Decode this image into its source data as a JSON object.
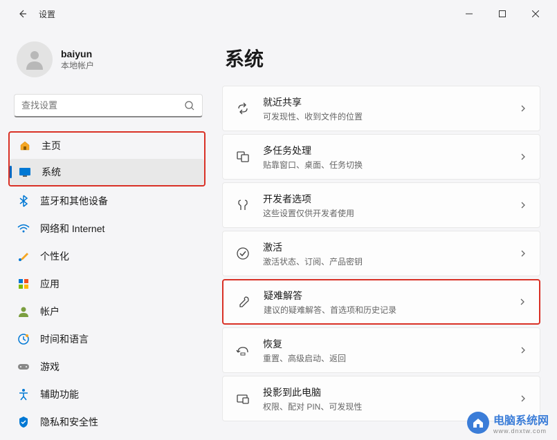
{
  "app": {
    "title": "设置"
  },
  "user": {
    "name": "baiyun",
    "account_type": "本地帐户"
  },
  "search": {
    "placeholder": "查找设置"
  },
  "nav": [
    {
      "id": "home",
      "label": "主页",
      "icon": "home"
    },
    {
      "id": "system",
      "label": "系统",
      "icon": "system",
      "active": true
    },
    {
      "id": "bluetooth",
      "label": "蓝牙和其他设备",
      "icon": "bluetooth"
    },
    {
      "id": "network",
      "label": "网络和 Internet",
      "icon": "wifi"
    },
    {
      "id": "personalization",
      "label": "个性化",
      "icon": "brush"
    },
    {
      "id": "apps",
      "label": "应用",
      "icon": "apps"
    },
    {
      "id": "accounts",
      "label": "帐户",
      "icon": "account"
    },
    {
      "id": "time",
      "label": "时间和语言",
      "icon": "time"
    },
    {
      "id": "gaming",
      "label": "游戏",
      "icon": "gaming"
    },
    {
      "id": "accessibility",
      "label": "辅助功能",
      "icon": "accessibility"
    },
    {
      "id": "privacy",
      "label": "隐私和安全性",
      "icon": "privacy"
    }
  ],
  "page": {
    "title": "系统"
  },
  "settings": [
    {
      "id": "nearby",
      "title": "就近共享",
      "desc": "可发现性、收到文件的位置",
      "icon": "share"
    },
    {
      "id": "multitask",
      "title": "多任务处理",
      "desc": "贴靠窗口、桌面、任务切换",
      "icon": "multitask"
    },
    {
      "id": "developer",
      "title": "开发者选项",
      "desc": "这些设置仅供开发者使用",
      "icon": "developer"
    },
    {
      "id": "activation",
      "title": "激活",
      "desc": "激活状态、订阅、产品密钥",
      "icon": "activation"
    },
    {
      "id": "troubleshoot",
      "title": "疑难解答",
      "desc": "建议的疑难解答、首选项和历史记录",
      "icon": "troubleshoot",
      "highlighted": true
    },
    {
      "id": "recovery",
      "title": "恢复",
      "desc": "重置、高级启动、返回",
      "icon": "recovery"
    },
    {
      "id": "projection",
      "title": "投影到此电脑",
      "desc": "权限、配对 PIN、可发现性",
      "icon": "projection"
    }
  ],
  "watermark": {
    "name": "电脑系统网",
    "url": "www.dnxtw.com"
  }
}
